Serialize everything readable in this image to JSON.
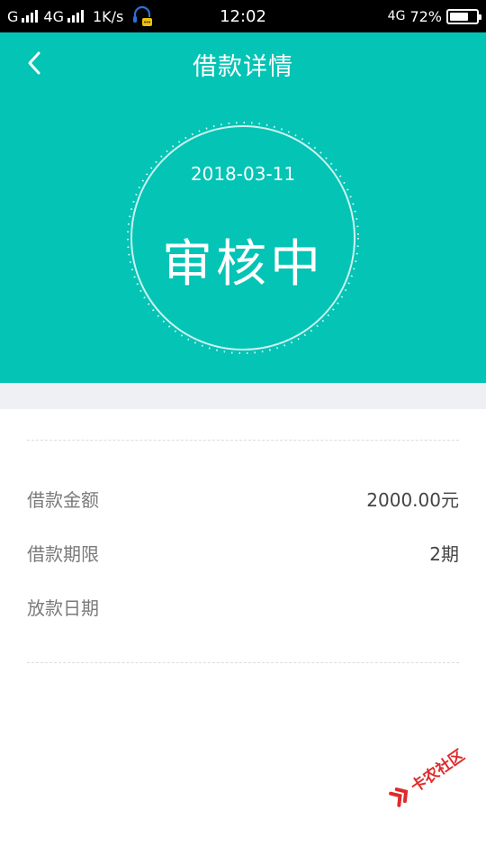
{
  "status_bar": {
    "sim1": "G",
    "sim2": "4G",
    "speed": "1K/s",
    "time": "12:02",
    "network": "4G",
    "battery": "72%",
    "battery_level": 0.72
  },
  "header": {
    "title": "借款详情",
    "date": "2018-03-11",
    "status": "审核中",
    "background_color": "#03c4b5"
  },
  "details": [
    {
      "label": "借款金额",
      "value": "2000.00元"
    },
    {
      "label": "借款期限",
      "value": "2期"
    },
    {
      "label": "放款日期",
      "value": ""
    }
  ],
  "watermark": {
    "text": "卡农社区"
  }
}
